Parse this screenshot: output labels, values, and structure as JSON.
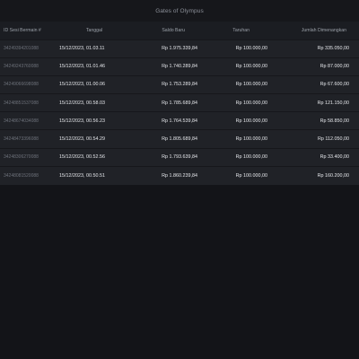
{
  "header": {
    "title": "Gates of Olympus"
  },
  "table": {
    "columns": [
      "ID Sesi Bermain #",
      "Tanggal",
      "Saldo Baru",
      "Taruhan",
      "Jumlah Dimenangkan"
    ],
    "rows": [
      {
        "id": "34249394201088",
        "date": "15/12/2023, 01.03.11",
        "saldo": "Rp 1.975.339,84",
        "bet": "Rp 100.000,00",
        "win": "Rp 335.050,00"
      },
      {
        "id": "34249243760088",
        "date": "15/12/2023, 01.01.46",
        "saldo": "Rp 1.740.289,84",
        "bet": "Rp 100.000,00",
        "win": "Rp 87.000,00"
      },
      {
        "id": "34249066698088",
        "date": "15/12/2023, 01.00.06",
        "saldo": "Rp 1.753.289,84",
        "bet": "Rp 100.000,00",
        "win": "Rp 67.600,00"
      },
      {
        "id": "34248851537088",
        "date": "15/12/2023, 00.58.03",
        "saldo": "Rp 1.785.689,84",
        "bet": "Rp 100.000,00",
        "win": "Rp 121.150,00"
      },
      {
        "id": "34248674034088",
        "date": "15/12/2023, 00.56.23",
        "saldo": "Rp 1.764.539,84",
        "bet": "Rp 100.000,00",
        "win": "Rp 58.850,00"
      },
      {
        "id": "34248473396088",
        "date": "15/12/2023, 00.54.29",
        "saldo": "Rp 1.805.689,84",
        "bet": "Rp 100.000,00",
        "win": "Rp 112.050,00"
      },
      {
        "id": "34248306270088",
        "date": "15/12/2023, 00.52.56",
        "saldo": "Rp 1.793.639,84",
        "bet": "Rp 100.000,00",
        "win": "Rp 33.400,00"
      },
      {
        "id": "34248081520088",
        "date": "15/12/2023, 00.50.51",
        "saldo": "Rp 1.860.239,84",
        "bet": "Rp 100.000,00",
        "win": "Rp 160.200,00"
      }
    ]
  }
}
